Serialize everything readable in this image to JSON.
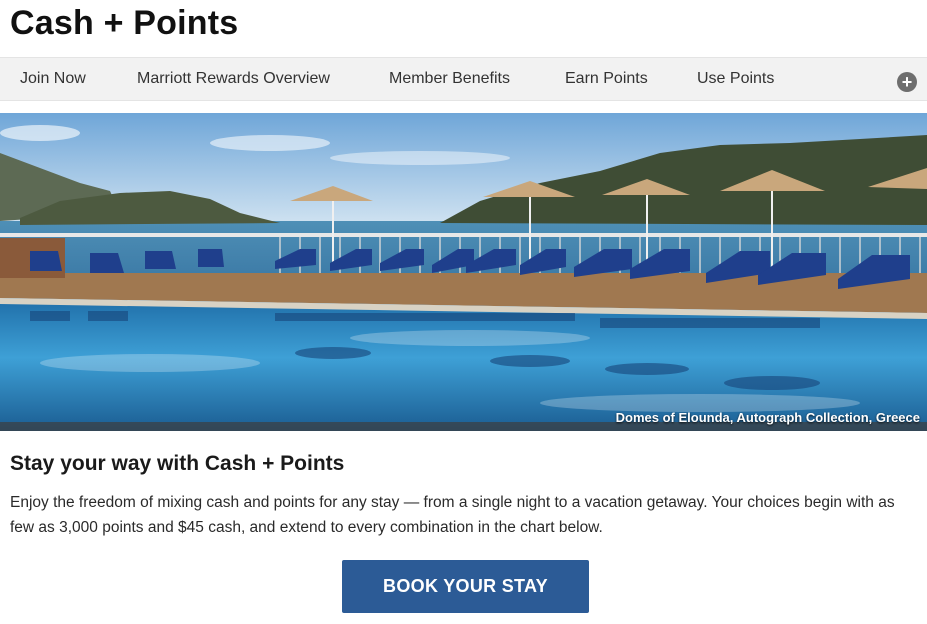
{
  "page": {
    "title": "Cash + Points"
  },
  "nav": {
    "items": [
      {
        "label": "Join Now"
      },
      {
        "label": "Marriott Rewards Overview"
      },
      {
        "label": "Member Benefits"
      },
      {
        "label": "Earn Points"
      },
      {
        "label": "Use Points"
      }
    ],
    "more_icon": "plus-circle-icon",
    "more_symbol": "+"
  },
  "hero": {
    "caption": "Domes of Elounda, Autograph Collection, Greece"
  },
  "section": {
    "heading": "Stay your way with Cash + Points",
    "body": "Enjoy the freedom of mixing cash and points for any stay — from a single night to a vacation getaway. Your choices begin with as few as 3,000 points and $45 cash, and extend to every combination in the chart below."
  },
  "cta": {
    "label": "BOOK YOUR STAY"
  },
  "colors": {
    "nav_background": "#f2f2f2",
    "button": "#2c5b96",
    "pool": "#2f8fc8",
    "lounger": "#1f3f8c"
  }
}
